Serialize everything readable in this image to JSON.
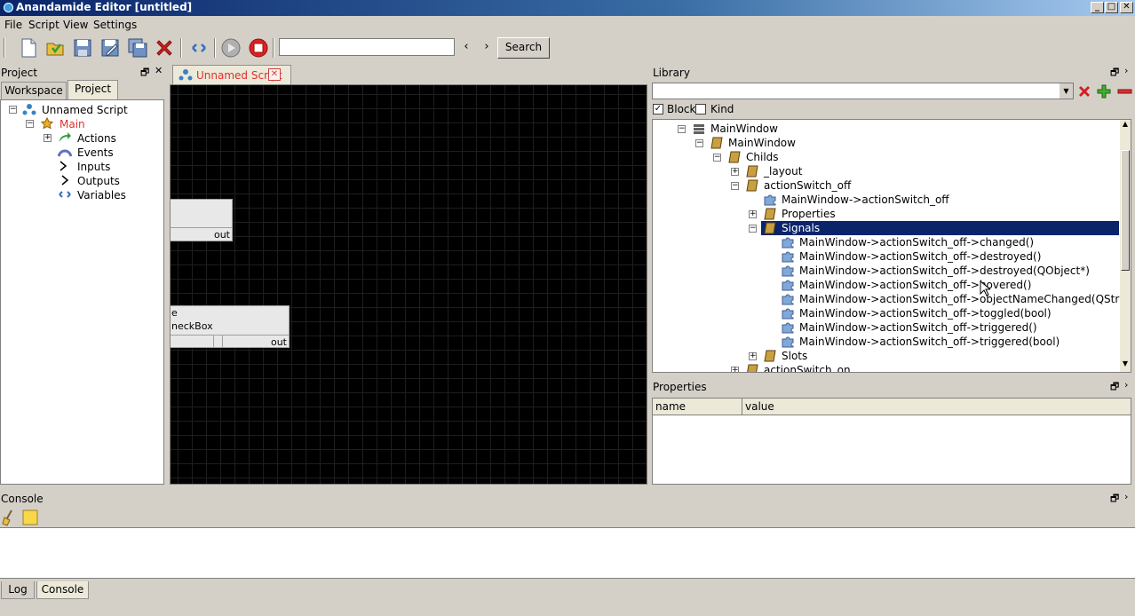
{
  "window": {
    "title": "Anandamide Editor [untitled]",
    "min_glyph": "_",
    "max_glyph": "□",
    "close_glyph": "✕"
  },
  "menu": [
    "File",
    "Script",
    "View",
    "Settings"
  ],
  "toolbar": {
    "search_value": "",
    "prev_glyph": "‹",
    "next_glyph": "›",
    "search_label": "Search"
  },
  "project": {
    "title": "Project",
    "tabs": [
      "Workspace",
      "Project"
    ],
    "tree": {
      "root": "Unnamed Script",
      "main": "Main",
      "children": [
        "Actions",
        "Events",
        "Inputs",
        "Outputs",
        "Variables"
      ]
    }
  },
  "editor": {
    "tab_label": "Unnamed Script",
    "node1_out": "out",
    "node2_line1": "e",
    "node2_line2": "neckBox",
    "node2_out": "out"
  },
  "library": {
    "title": "Library",
    "block_label": "Block",
    "block_checked": true,
    "kind_label": "Kind",
    "kind_checked": false,
    "tree": {
      "root": "MainWindow",
      "mainwindow": "MainWindow",
      "childs": "Childs",
      "layout": "_layout",
      "action": "actionSwitch_off",
      "action_ref": "MainWindow->actionSwitch_off",
      "properties": "Properties",
      "signals": "Signals",
      "signal_items": [
        "MainWindow->actionSwitch_off->changed()",
        "MainWindow->actionSwitch_off->destroyed()",
        "MainWindow->actionSwitch_off->destroyed(QObject*)",
        "MainWindow->actionSwitch_off->hovered()",
        "MainWindow->actionSwitch_off->objectNameChanged(QString)",
        "MainWindow->actionSwitch_off->toggled(bool)",
        "MainWindow->actionSwitch_off->triggered()",
        "MainWindow->actionSwitch_off->triggered(bool)"
      ],
      "slots": "Slots",
      "next": "actionSwitch_on"
    }
  },
  "properties": {
    "title": "Properties",
    "col_name": "name",
    "col_value": "value"
  },
  "console": {
    "title": "Console",
    "tabs": [
      "Log",
      "Console"
    ]
  }
}
